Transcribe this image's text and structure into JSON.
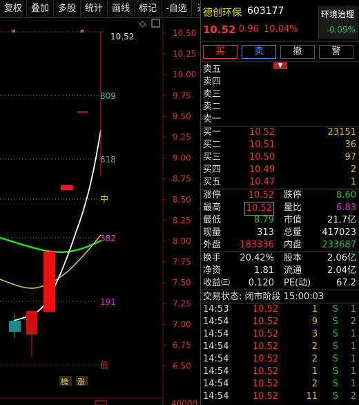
{
  "toolbar": {
    "items": [
      "复权",
      "叠加",
      "多股",
      "统计",
      "画线",
      "标记",
      "-自选",
      "返回"
    ]
  },
  "chart": {
    "price_labels": [
      "10.52",
      "10.50",
      "10.25",
      "10.00",
      "9.75",
      "9.50",
      "9.25",
      "9.00",
      "8.75",
      "8.50",
      "8.25",
      "8.00",
      "7.75",
      "7.50",
      "7.25",
      "7.00",
      "6.75",
      "6.50"
    ],
    "volume_label": "40000",
    "fib_levels": [
      {
        "label": "809",
        "color": "#20c0c0"
      },
      {
        "label": "618",
        "color": "#909090"
      },
      {
        "label": "中",
        "color": "#e0e000"
      },
      {
        "label": "382",
        "color": "#e040e0"
      },
      {
        "label": "191",
        "color": "#e020e0"
      },
      {
        "label": "低",
        "color": "#e03030"
      }
    ],
    "badges": [
      "榜",
      "涨"
    ],
    "colors": {
      "up": "#ff2020",
      "down": "#20a0a0",
      "ma_fast": "#ffffff",
      "ma_mid": "#e0c020",
      "ma_slow": "#20e020"
    }
  },
  "header": {
    "name": "德创环保",
    "code": "603177",
    "price": "10.52",
    "change": "0.96",
    "change_pct": "10.04%",
    "sector_name": "环境治理",
    "sector_pct": "-0.09%"
  },
  "actions": {
    "buy": "买",
    "sell": "卖",
    "cancel": "撤",
    "alert": "警"
  },
  "asks": [
    {
      "label": "卖五",
      "price": "",
      "vol": ""
    },
    {
      "label": "卖四",
      "price": "",
      "vol": ""
    },
    {
      "label": "卖三",
      "price": "",
      "vol": ""
    },
    {
      "label": "卖二",
      "price": "",
      "vol": ""
    },
    {
      "label": "卖一",
      "price": "",
      "vol": ""
    }
  ],
  "bids": [
    {
      "label": "买一",
      "price": "10.52",
      "vol": "23151"
    },
    {
      "label": "买二",
      "price": "10.51",
      "vol": "36"
    },
    {
      "label": "买三",
      "price": "10.50",
      "vol": "97"
    },
    {
      "label": "买四",
      "price": "10.49",
      "vol": "2"
    },
    {
      "label": "买五",
      "price": "10.47",
      "vol": "1"
    }
  ],
  "stats1": [
    {
      "a": "涨停",
      "av": "10.52",
      "ac": "red",
      "b": "跌停",
      "bv": "8.60",
      "bc": "green"
    },
    {
      "a": "最高",
      "av": "10.52",
      "ac": "red",
      "b": "量比",
      "bv": "6.83",
      "bc": "magenta",
      "boxed": true
    },
    {
      "a": "最低",
      "av": "8.79",
      "ac": "green",
      "b": "市值",
      "bv": "21.7亿",
      "bc": "white"
    },
    {
      "a": "现量",
      "av": "313",
      "ac": "white",
      "b": "总量",
      "bv": "417023",
      "bc": "white"
    },
    {
      "a": "外盘",
      "av": "183336",
      "ac": "red",
      "b": "内盘",
      "bv": "233687",
      "bc": "green"
    }
  ],
  "stats2": [
    {
      "a": "换手",
      "av": "20.42%",
      "ac": "white",
      "b": "股本",
      "bv": "2.06亿",
      "bc": "white"
    },
    {
      "a": "净资",
      "av": "1.81",
      "ac": "white",
      "b": "流通",
      "bv": "2.04亿",
      "bc": "white"
    },
    {
      "a": "收益㈢",
      "av": "0.120",
      "ac": "white",
      "b": "PE(动)",
      "bv": "67.2",
      "bc": "white"
    }
  ],
  "status": {
    "label": "交易状态:",
    "value": "闭市阶段 15:00:03"
  },
  "ticks": [
    {
      "t": "14:53",
      "p": "10.52",
      "v": "1",
      "f": "S",
      "n": "1"
    },
    {
      "t": "14:54",
      "p": "10.52",
      "v": "9",
      "f": "S",
      "n": "2"
    },
    {
      "t": "14:54",
      "p": "10.52",
      "v": "3",
      "f": "S",
      "n": "1"
    },
    {
      "t": "14:54",
      "p": "10.52",
      "v": "2",
      "f": "S",
      "n": "1"
    },
    {
      "t": "14:54",
      "p": "10.52",
      "v": "2",
      "f": "S",
      "n": "1"
    },
    {
      "t": "14:54",
      "p": "10.52",
      "v": "1",
      "f": "S",
      "n": "1"
    },
    {
      "t": "14:54",
      "p": "10.52",
      "v": "2",
      "f": "S",
      "n": "1"
    },
    {
      "t": "14:54",
      "p": "10.52",
      "v": "11",
      "f": "S",
      "n": "2"
    }
  ]
}
